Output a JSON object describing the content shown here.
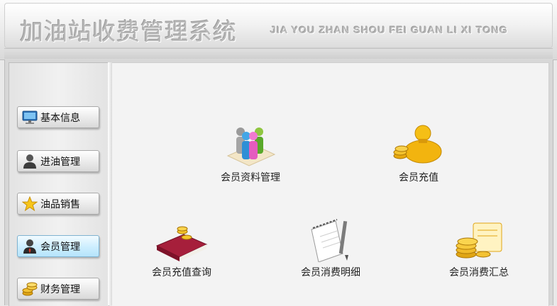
{
  "header": {
    "title": "加油站收费管理系统",
    "subtitle": "JIA YOU ZHAN SHOU FEI GUAN LI XI TONG"
  },
  "sidebar": {
    "items": [
      {
        "label": "基本信息",
        "icon": "monitor-icon"
      },
      {
        "label": "进油管理",
        "icon": "user-dark-icon"
      },
      {
        "label": "油品销售",
        "icon": "star-icon"
      },
      {
        "label": "会员管理",
        "icon": "businessman-icon",
        "active": true
      },
      {
        "label": "财务管理",
        "icon": "coins-icon"
      }
    ]
  },
  "main": {
    "tiles": [
      {
        "label": "会员资料管理",
        "icon": "people-group-icon"
      },
      {
        "label": "会员充值",
        "icon": "gold-bag-icon"
      },
      {
        "label": "会员充值查询",
        "icon": "ledger-book-icon"
      },
      {
        "label": "会员消费明细",
        "icon": "notepad-pen-icon"
      },
      {
        "label": "会员消费汇总",
        "icon": "coins-card-icon"
      }
    ]
  },
  "colors": {
    "accent_active": "#b5e4fb",
    "gold": "#e6b21c",
    "title_text": "#b8b8b8"
  }
}
